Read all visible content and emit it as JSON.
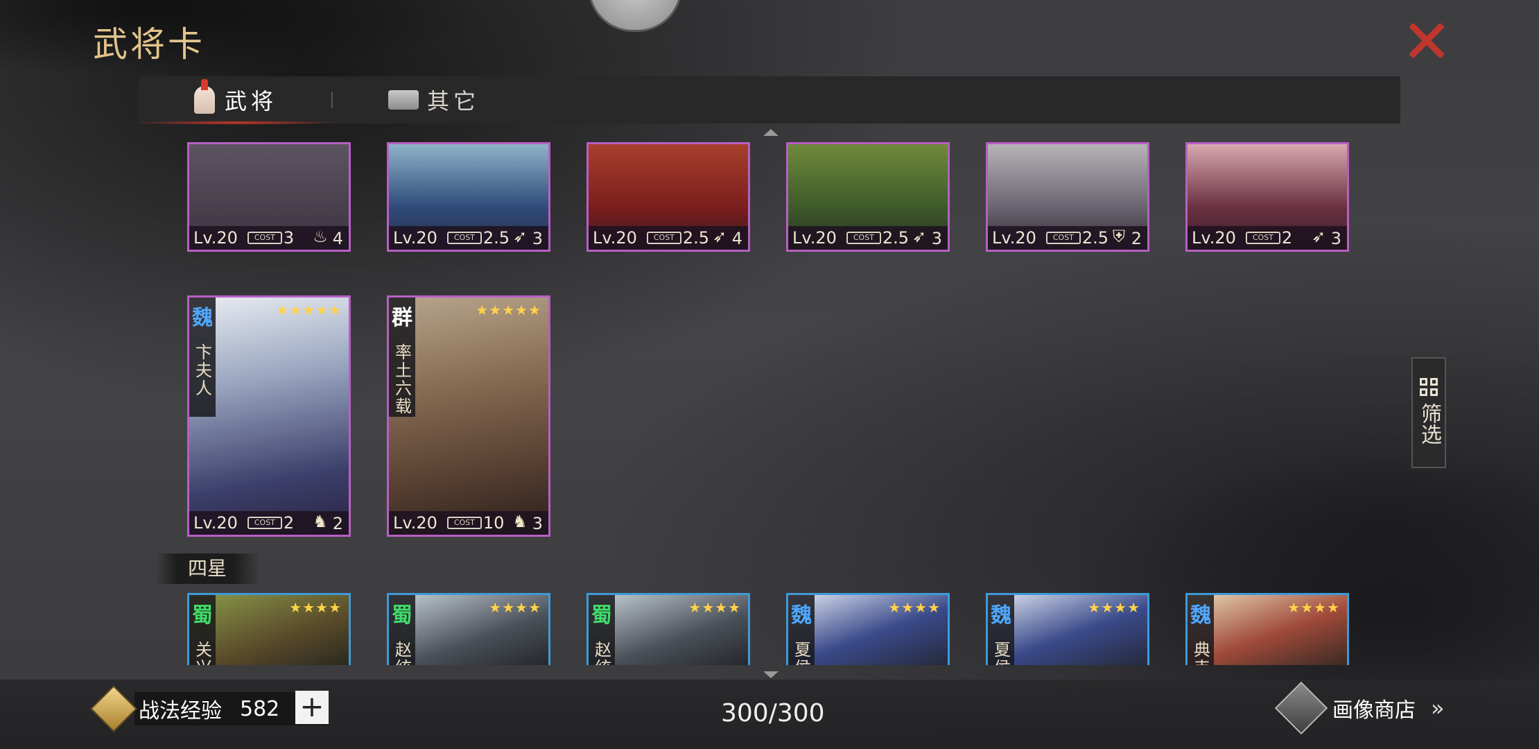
{
  "title": "武将卡",
  "tabs": [
    {
      "label": "武将",
      "active": true
    },
    {
      "label": "其它",
      "active": false
    }
  ],
  "top_row_cards": [
    {
      "level": "Lv.20",
      "cost_icon": "COST",
      "cost": "3",
      "type_icon": "fire-icon",
      "count": "4"
    },
    {
      "level": "Lv.20",
      "cost_icon": "COST",
      "cost": "2.5",
      "type_icon": "bow-icon",
      "count": "3"
    },
    {
      "level": "Lv.20",
      "cost_icon": "COST",
      "cost": "2.5",
      "type_icon": "bow-icon",
      "count": "4"
    },
    {
      "level": "Lv.20",
      "cost_icon": "COST",
      "cost": "2.5",
      "type_icon": "bow-icon",
      "count": "3"
    },
    {
      "level": "Lv.20",
      "cost_icon": "COST",
      "cost": "2.5",
      "type_icon": "shield-icon",
      "count": "2"
    },
    {
      "level": "Lv.20",
      "cost_icon": "COST",
      "cost": "2",
      "type_icon": "bow-icon",
      "count": "3"
    }
  ],
  "five_star_cards": [
    {
      "faction": "魏",
      "faction_color": "#4fa7ff",
      "name": "卞夫人",
      "stars": "★★★★★",
      "level": "Lv.20",
      "cost_icon": "COST",
      "cost": "2",
      "type_icon": "horse-icon",
      "count": "2"
    },
    {
      "faction": "群",
      "faction_color": "#ffffff",
      "name": "率土六载",
      "stars": "★★★★★",
      "level": "Lv.20",
      "cost_icon": "COST",
      "cost": "10",
      "type_icon": "horse-icon",
      "count": "3"
    }
  ],
  "section_four_star": "四星",
  "four_star_cards": [
    {
      "faction": "蜀",
      "faction_color": "#3fdc6a",
      "name": "关兴",
      "stars": "★★★★"
    },
    {
      "faction": "蜀",
      "faction_color": "#3fdc6a",
      "name": "赵统",
      "stars": "★★★★"
    },
    {
      "faction": "蜀",
      "faction_color": "#3fdc6a",
      "name": "赵统",
      "stars": "★★★★"
    },
    {
      "faction": "魏",
      "faction_color": "#4fa7ff",
      "name": "夏侯",
      "stars": "★★★★"
    },
    {
      "faction": "魏",
      "faction_color": "#4fa7ff",
      "name": "夏侯",
      "stars": "★★★★"
    },
    {
      "faction": "魏",
      "faction_color": "#4fa7ff",
      "name": "典韦",
      "stars": "★★★★"
    }
  ],
  "filter_label": "筛选",
  "bottom": {
    "exp_label": "战法经验",
    "exp_value": "582",
    "plus": "+",
    "card_count": "300/300",
    "shop_label": "画像商店",
    "shop_chevron": "»"
  }
}
